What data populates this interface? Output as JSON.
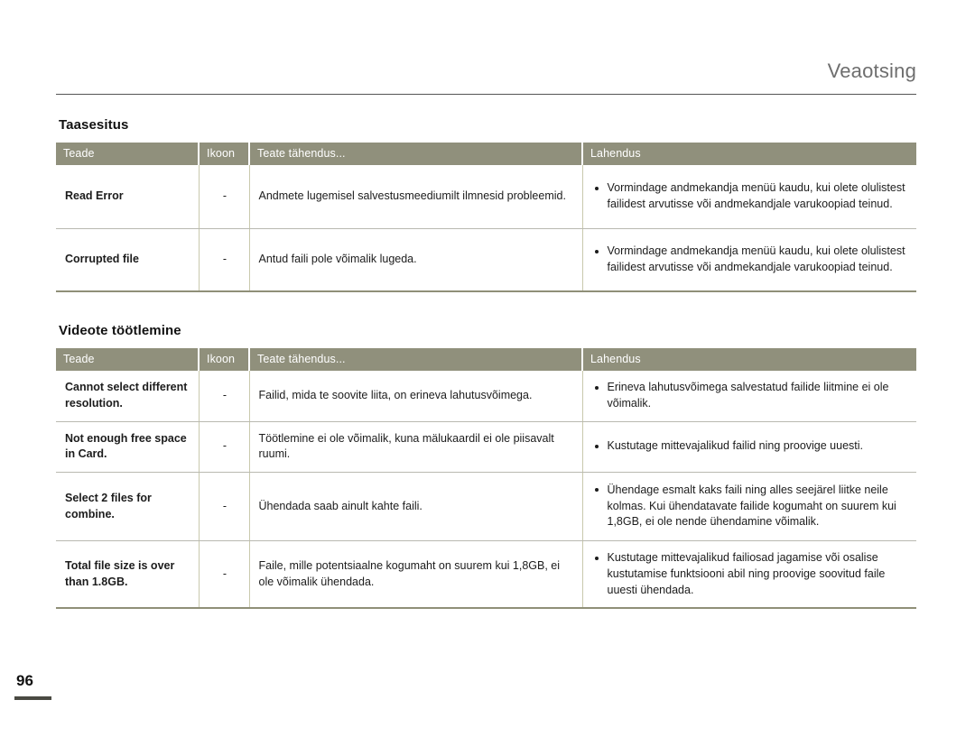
{
  "header": {
    "running_head": "Veaotsing"
  },
  "folio": {
    "page_number": "96"
  },
  "colors": {
    "table_header_bg": "#90907c",
    "table_header_text": "#ffffff",
    "running_head_text": "#6e6e6e",
    "folio_rule": "#4a4a42",
    "row_divider": "#b9b9b0"
  },
  "sections": [
    {
      "title": "Taasesitus",
      "columns": [
        "Teade",
        "Ikoon",
        "Teate tähendus...",
        "Lahendus"
      ],
      "rows": [
        {
          "message": "Read Error",
          "icon": "-",
          "meaning": "Andmete lugemisel salvestusmeediumilt ilmnesid probleemid.",
          "solutions": [
            "Vormindage andmekandja menüü kaudu, kui olete olulistest failidest arvutisse või andmekandjale varukoopiad teinud."
          ]
        },
        {
          "message": "Corrupted file",
          "icon": "-",
          "meaning": "Antud faili pole võimalik lugeda.",
          "solutions": [
            "Vormindage andmekandja menüü kaudu, kui olete olulistest failidest arvutisse või andmekandjale varukoopiad teinud."
          ]
        }
      ]
    },
    {
      "title": "Videote töötlemine",
      "columns": [
        "Teade",
        "Ikoon",
        "Teate tähendus...",
        "Lahendus"
      ],
      "rows": [
        {
          "message": "Cannot select different resolution.",
          "icon": "-",
          "meaning": "Failid, mida te soovite liita, on erineva lahutusvõimega.",
          "solutions": [
            "Erineva lahutusvõimega salvestatud failide liitmine ei ole võimalik."
          ]
        },
        {
          "message": "Not enough free space in Card.",
          "icon": "-",
          "meaning": "Töötlemine ei ole võimalik, kuna mälukaardil ei ole piisavalt ruumi.",
          "solutions": [
            "Kustutage mittevajalikud failid ning proovige uuesti."
          ]
        },
        {
          "message": "Select 2 files for combine.",
          "icon": "-",
          "meaning": "Ühendada saab ainult kahte faili.",
          "solutions": [
            "Ühendage esmalt kaks faili ning alles seejärel liitke neile kolmas. Kui ühendatavate failide kogumaht on suurem kui 1,8GB, ei ole nende ühendamine võimalik."
          ]
        },
        {
          "message": "Total file size is over than 1.8GB.",
          "icon": "-",
          "meaning": "Faile, mille potentsiaalne kogumaht on suurem kui 1,8GB, ei ole võimalik ühendada.",
          "solutions": [
            "Kustutage mittevajalikud failiosad jagamise või osalise kustutamise funktsiooni abil ning proovige soovitud faile uuesti ühendada."
          ]
        }
      ]
    }
  ]
}
